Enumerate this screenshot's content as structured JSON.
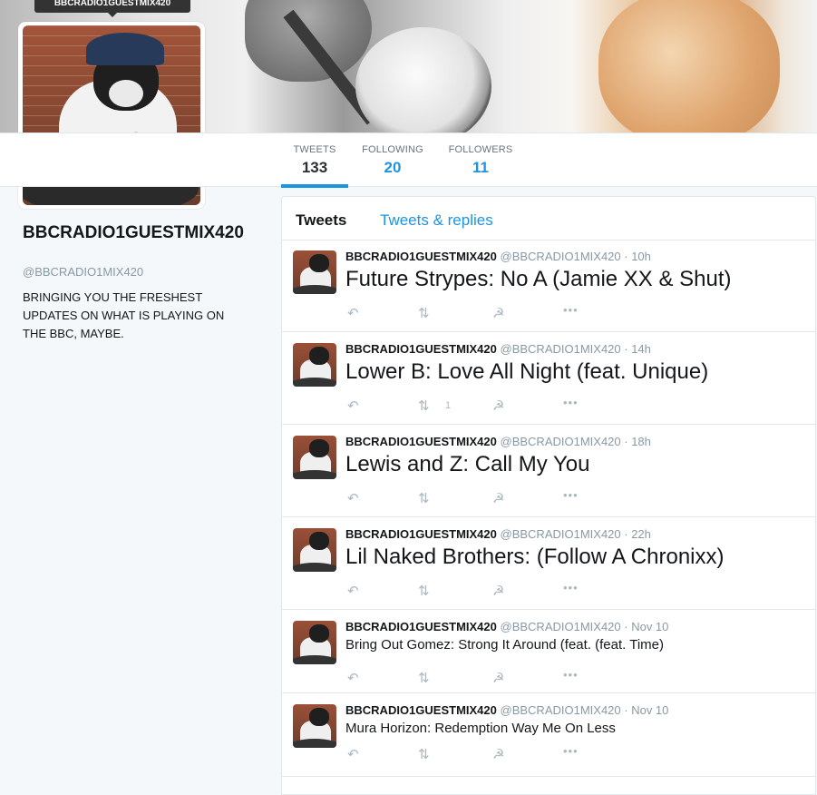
{
  "tooltip": "BBCRADIO1GUESTMIX420",
  "profile": {
    "name": "BBCRADIO1GUESTMIX420",
    "handle": "@BBCRADIO1MIX420",
    "bio": "BRINGING YOU THE FRESHEST UPDATES ON WHAT IS PLAYING ON THE BBC, MAYBE."
  },
  "stats": [
    {
      "label": "TWEETS",
      "value": "133"
    },
    {
      "label": "FOLLOWING",
      "value": "20"
    },
    {
      "label": "FOLLOWERS",
      "value": "11"
    }
  ],
  "tabs": [
    "Tweets",
    "Tweets & replies"
  ],
  "icons": {
    "reply": "reply-icon",
    "retweet": "retweet-icon",
    "favorite": "hammer-sickle-icon",
    "more": "more-icon"
  },
  "colors": {
    "accent": "#1b95e0",
    "muted": "#8899a6",
    "background": "#f5f8fa"
  },
  "tweets": [
    {
      "name": "BBCRADIO1GUESTMIX420",
      "handle": "@BBCRADIO1MIX420",
      "time": "· 10h",
      "text": "Future Strypes: No A (Jamie XX & Shut)",
      "retweets": ""
    },
    {
      "name": "BBCRADIO1GUESTMIX420",
      "handle": "@BBCRADIO1MIX420",
      "time": "· 14h",
      "text": "Lower B: Love All Night (feat. Unique)",
      "retweets": "1"
    },
    {
      "name": "BBCRADIO1GUESTMIX420",
      "handle": "@BBCRADIO1MIX420",
      "time": "· 18h",
      "text": "Lewis and Z: Call My You",
      "retweets": ""
    },
    {
      "name": "BBCRADIO1GUESTMIX420",
      "handle": "@BBCRADIO1MIX420",
      "time": "· 22h",
      "text": "Lil Naked Brothers: (Follow A Chronixx)",
      "retweets": ""
    },
    {
      "name": "BBCRADIO1GUESTMIX420",
      "handle": "@BBCRADIO1MIX420",
      "time": "· Nov 10",
      "text": "Bring Out Gomez: Strong It Around (feat. (feat. Time)",
      "retweets": ""
    },
    {
      "name": "BBCRADIO1GUESTMIX420",
      "handle": "@BBCRADIO1MIX420",
      "time": "· Nov 10",
      "text": "Mura Horizon: Redemption Way Me On Less",
      "retweets": ""
    }
  ]
}
